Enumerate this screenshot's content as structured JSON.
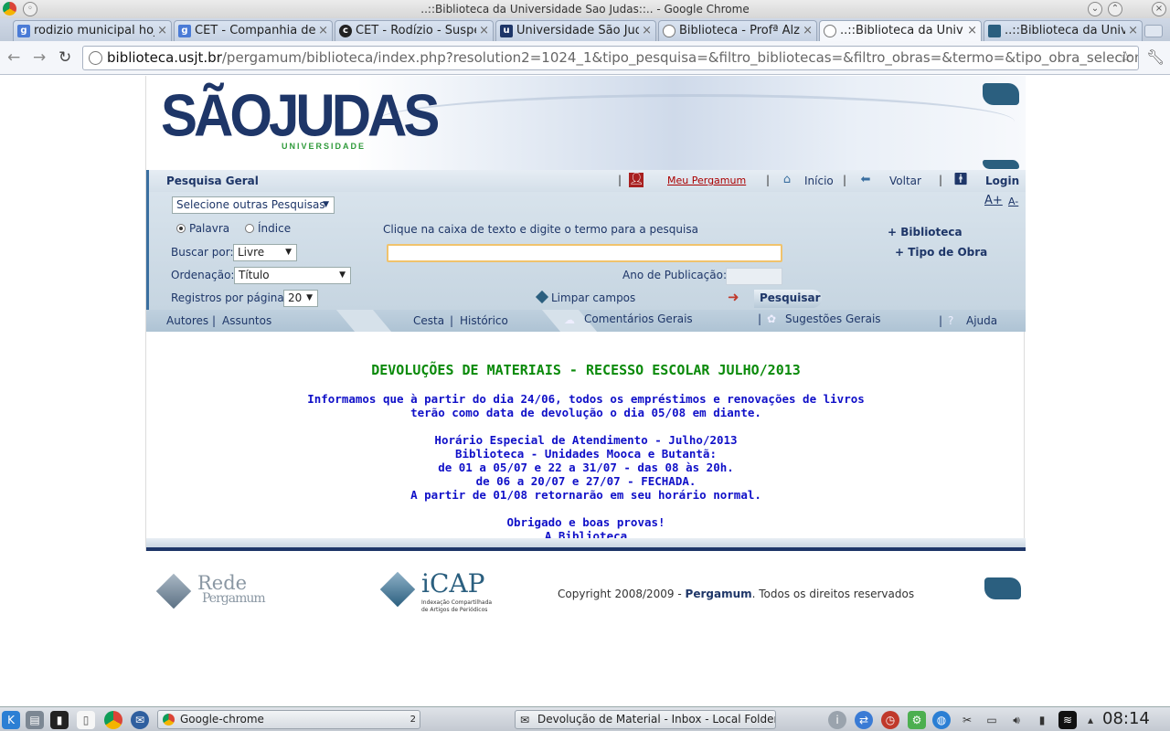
{
  "window": {
    "title": "..::Biblioteca da Universidade Sao Judas::.. - Google Chrome"
  },
  "tabs": [
    {
      "label": "rodizio municipal hoje",
      "icon": "google-icon"
    },
    {
      "label": "CET - Companhia de",
      "icon": "google-icon"
    },
    {
      "label": "CET - Rodízio - Suspenso",
      "icon": "cet-icon"
    },
    {
      "label": "Universidade São Judas",
      "icon": "usjt-icon"
    },
    {
      "label": "Biblioteca - Profª Alzira",
      "icon": "globe-icon"
    },
    {
      "label": "..::Biblioteca da Univ",
      "icon": "globe-icon"
    },
    {
      "label": "..::Biblioteca da Univ",
      "icon": "pergamum-icon"
    }
  ],
  "address": {
    "url_host": "biblioteca.usjt.br",
    "url_path": "/pergamum/biblioteca/index.php?resolution2=1024_1&tipo_pesquisa=&filtro_bibliotecas=&filtro_obras=&termo=&tipo_obra_selecionados="
  },
  "brand": {
    "logo_text": "SÃOJUDAS",
    "logo_sub": "UNIVERSIDADE",
    "primary_color": "#1e3668",
    "accent_color": "#2e9a3a"
  },
  "topnav": {
    "section_title": "Pesquisa Geral",
    "meu_pergamum": "Meu Pergamum",
    "inicio": "Início",
    "voltar": "Voltar",
    "login": "Login",
    "font_plus": "A+",
    "font_minus": "A-"
  },
  "search": {
    "other_searches": "Selecione outras Pesquisas",
    "radio_palavra": "Palavra",
    "radio_indice": "Índice",
    "hint": "Clique na caixa de texto e digite o termo para a pesquisa",
    "term_value": "",
    "buscar_label": "Buscar por:",
    "buscar_value": "Livre",
    "ordenacao_label": "Ordenação:",
    "ordenacao_value": "Título",
    "ano_label": "Ano de Publicação:",
    "ano_value": "",
    "registros_label": "Registros por página:",
    "registros_value": "20",
    "limpar": "Limpar campos",
    "pesquisar": "Pesquisar",
    "biblioteca": "+ Biblioteca",
    "tipo_obra": "+ Tipo de Obra"
  },
  "subnav": {
    "autores": "Autores",
    "assuntos": "Assuntos",
    "cesta": "Cesta",
    "historico": "Histórico",
    "comentarios": "Comentários Gerais",
    "sugestoes": "Sugestões Gerais",
    "ajuda": "Ajuda"
  },
  "notice": {
    "title": "DEVOLUÇÕES DE MATERIAIS - RECESSO ESCOLAR JULHO/2013",
    "lines": [
      "Informamos que à partir do dia 24/06, todos os empréstimos e renovações de livros",
      "terão como data de devolução o dia 05/08 em diante.",
      "Horário Especial de Atendimento - Julho/2013",
      "Biblioteca - Unidades Mooca e Butantã:",
      "de 01 a 05/07 e 22 a 31/07 - das 08 às 20h.",
      "de 06 a 20/07 e 27/07 - FECHADA.",
      "A partir de 01/08 retornarão em seu horário normal.",
      "Obrigado e boas provas!",
      "A Biblioteca"
    ]
  },
  "footer": {
    "rede": "Rede",
    "pergamum_logo": "Pergamum",
    "icap": "iCAP",
    "icap_sub1": "Indexação Compartilhada",
    "icap_sub2": "de Artigos de Periódicos",
    "copyright_prefix": "Copyright 2008/2009 -",
    "copyright_brand": "Pergamum",
    "copyright_suffix": ". Todos os direitos reservados"
  },
  "taskbar": {
    "task1": "Google-chrome",
    "task1_count": "2",
    "task2": "Devolução de Material - Inbox - Local Folders -",
    "clock": "08:14"
  }
}
